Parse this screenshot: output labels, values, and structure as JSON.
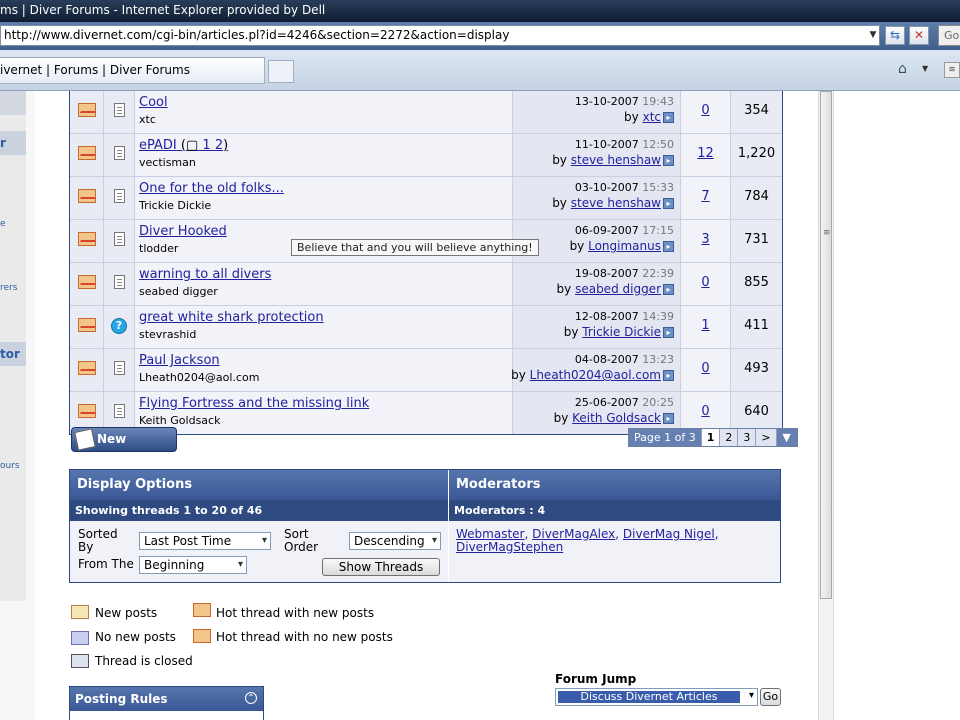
{
  "browser": {
    "title": "ms | Diver Forums - Internet Explorer provided by Dell",
    "url": "http://www.divernet.com/cgi-bin/articles.pl?id=4246&section=2272&action=display",
    "tab_label": "ivernet | Forums | Diver Forums",
    "go_label": "Go"
  },
  "left_panel": {
    "heads": [
      "r",
      "tor"
    ],
    "texts": [
      "e",
      "rers",
      "ours"
    ]
  },
  "threads": [
    {
      "title": "Cool",
      "author": "xtc",
      "date": "13-10-2007",
      "time": "19:43",
      "by": "xtc",
      "replies": "0",
      "views": "354",
      "icon": "doc"
    },
    {
      "title": "ePADI",
      "pages": [
        "1",
        "2"
      ],
      "author": "vectisman",
      "date": "11-10-2007",
      "time": "12:50",
      "by": "steve henshaw",
      "replies": "12",
      "views": "1,220",
      "icon": "doc"
    },
    {
      "title": "One for the old folks...",
      "author": "Trickie Dickie",
      "date": "03-10-2007",
      "time": "15:33",
      "by": "steve henshaw",
      "replies": "7",
      "views": "784",
      "icon": "doc"
    },
    {
      "title": "Diver Hooked",
      "author": "tlodder",
      "date": "06-09-2007",
      "time": "17:15",
      "by": "Longimanus",
      "replies": "3",
      "views": "731",
      "icon": "doc"
    },
    {
      "title": "warning to all divers",
      "author": "seabed digger",
      "date": "19-08-2007",
      "time": "22:39",
      "by": "seabed digger",
      "replies": "0",
      "views": "855",
      "icon": "doc"
    },
    {
      "title": "great white shark protection",
      "author": "stevrashid",
      "date": "12-08-2007",
      "time": "14:39",
      "by": "Trickie Dickie",
      "replies": "1",
      "views": "411",
      "icon": "question"
    },
    {
      "title": "Paul Jackson",
      "author": "Lheath0204@aol.com",
      "date": "04-08-2007",
      "time": "13:23",
      "by": "Lheath0204@aol.com",
      "replies": "0",
      "views": "493",
      "icon": "doc"
    },
    {
      "title": "Flying Fortress and the missing link",
      "author": "Keith Goldsack",
      "date": "25-06-2007",
      "time": "20:25",
      "by": "Keith Goldsack",
      "replies": "0",
      "views": "640",
      "icon": "doc"
    }
  ],
  "tooltip": "Believe that and you will believe anything!",
  "new_thread_label": "New Thread",
  "pagination": {
    "label": "Page 1 of 3",
    "pages": [
      "1",
      "2",
      "3"
    ],
    "current": "1",
    "next": ">",
    "menu": "▼"
  },
  "display_options": {
    "title": "Display Options",
    "showing": "Showing threads 1 to 20 of 46",
    "sorted_by_label": "Sorted By",
    "sorted_by_value": "Last Post Time",
    "sort_order_label": "Sort Order",
    "sort_order_value": "Descending",
    "from_label": "From The",
    "from_value": "Beginning",
    "show_button": "Show Threads"
  },
  "moderators": {
    "title": "Moderators",
    "count": "Moderators : 4",
    "names": [
      "Webmaster",
      "DiverMagAlex",
      "DiverMag Nigel",
      "DiverMagStephen"
    ]
  },
  "legend": {
    "new_posts": "New posts",
    "hot_new": "Hot thread with new posts",
    "no_new": "No new posts",
    "hot_no_new": "Hot thread with no new posts",
    "closed": "Thread is closed"
  },
  "forum_jump": {
    "label": "Forum Jump",
    "selected": "Discuss Divernet Articles",
    "go": "Go"
  },
  "posting_rules": {
    "title": "Posting Rules"
  },
  "colors": {
    "header_blue": "#3a5894",
    "link": "#22229c",
    "row_bg": "#f2f3f8"
  }
}
